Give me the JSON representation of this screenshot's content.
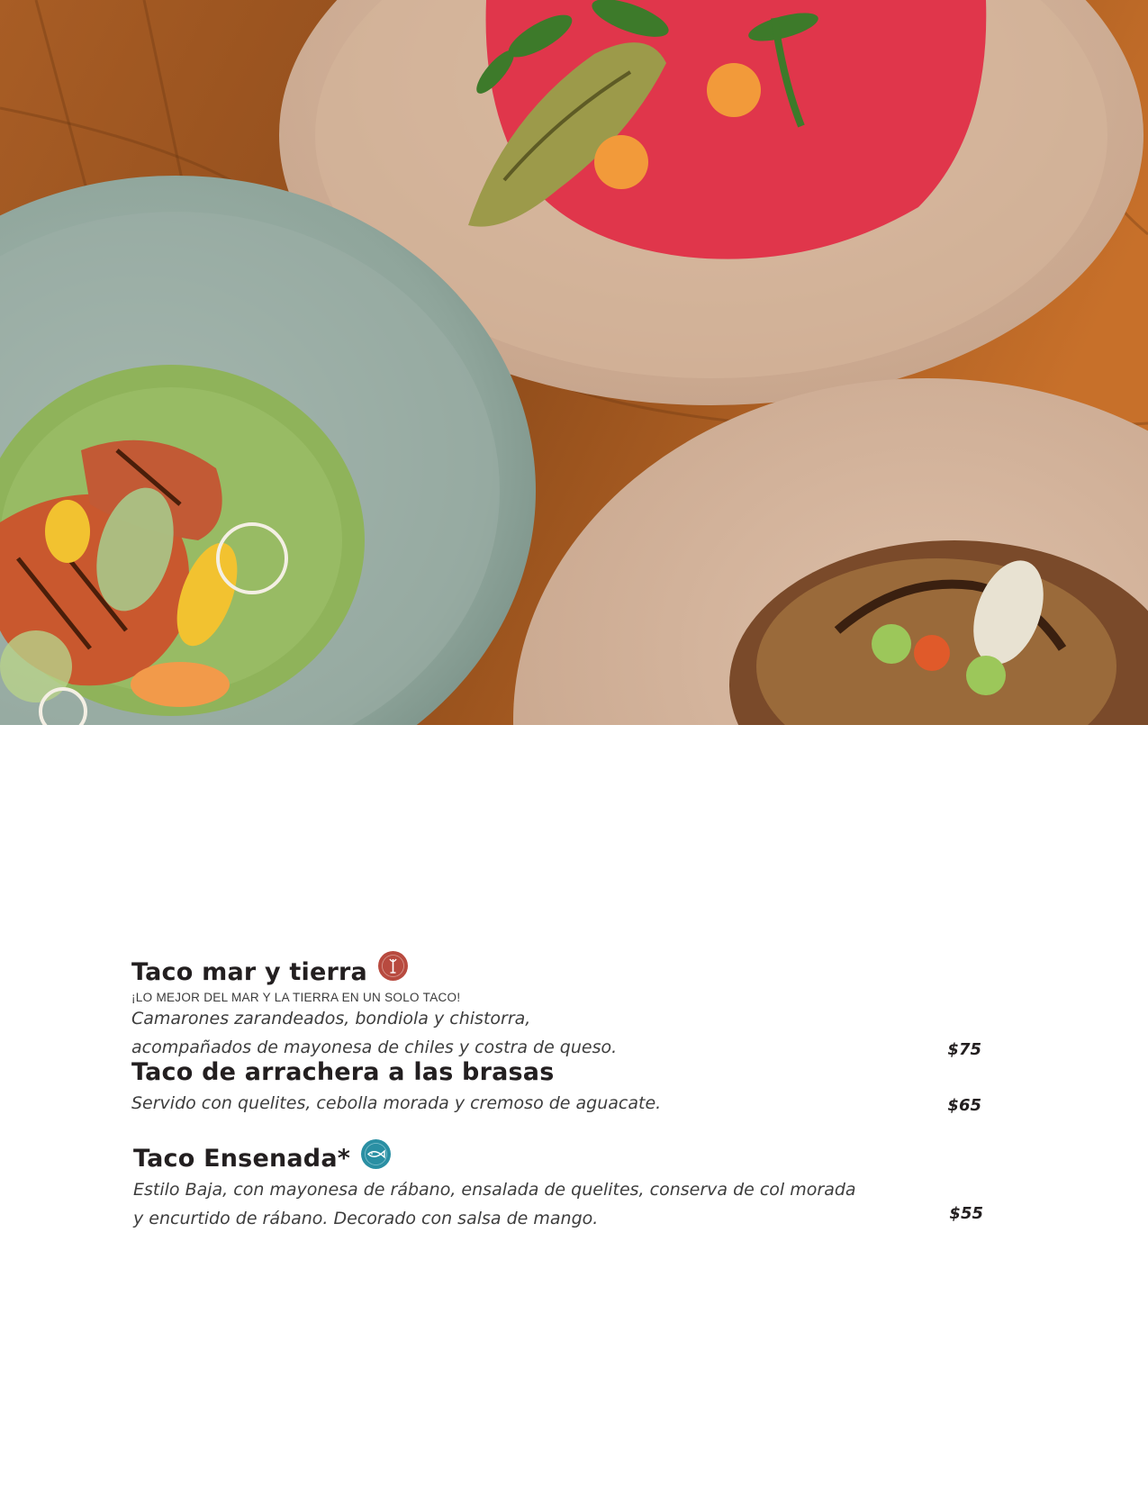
{
  "photo": {
    "description_icon": "food-photo",
    "colors": {
      "wood": "#9a5420",
      "plate_sage": "#95aaa1",
      "plate_clay": "#d8b8a0",
      "tortilla_red": "#e2394a",
      "tortilla_green": "#8fb35a"
    }
  },
  "menu": {
    "items": [
      {
        "title": "Taco mar y tierra",
        "badge_icon": "shrimp-icon",
        "badge_color": "#b84a3f",
        "tagline": "¡LO MEJOR DEL MAR Y LA TIERRA EN UN SOLO TACO!",
        "desc_line1": "Camarones zarandeados, bondiola y chistorra,",
        "desc_line2": "acompañados de mayonesa de chiles y costra de queso.",
        "price": "$75"
      },
      {
        "title": "Taco de arrachera a las brasas",
        "desc_line1": "Servido con quelites, cebolla morada y cremoso de aguacate.",
        "price": "$65"
      },
      {
        "title": "Taco Ensenada*",
        "badge_icon": "fish-icon",
        "badge_color": "#2a8fa3",
        "desc_line1": "Estilo Baja, con mayonesa de rábano, ensalada de quelites, conserva de col morada",
        "desc_line2": "y encurtido de rábano. Decorado con salsa de mango.",
        "price": "$55"
      }
    ]
  }
}
